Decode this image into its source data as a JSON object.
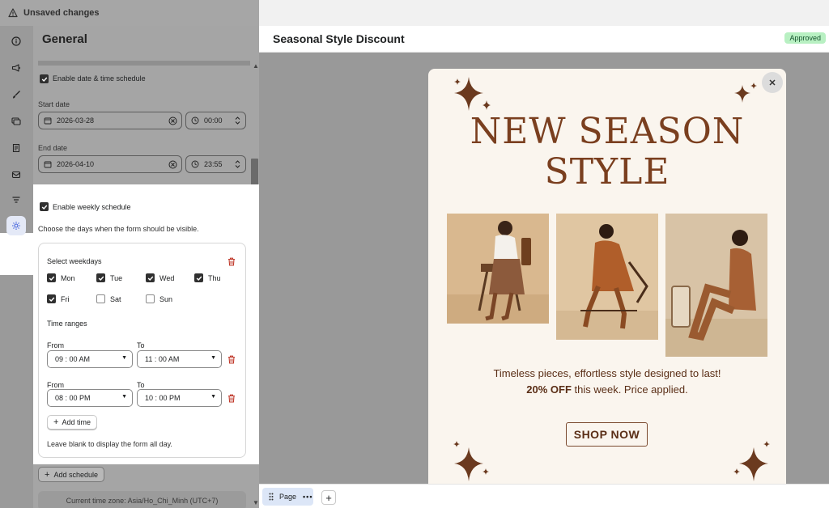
{
  "topbar": {
    "status": "Unsaved changes"
  },
  "panel": {
    "title": "General",
    "schedule": {
      "enable_label": "Enable date & time schedule",
      "start_label": "Start date",
      "start_date": "2026-03-28",
      "start_time": "00:00",
      "end_label": "End date",
      "end_date": "2026-04-10",
      "end_time": "23:55"
    },
    "weekly": {
      "enable_label": "Enable weekly schedule",
      "description": "Choose the days when the form should be visible.",
      "weekdays_label": "Select weekdays",
      "days": [
        {
          "label": "Mon",
          "checked": true
        },
        {
          "label": "Tue",
          "checked": true
        },
        {
          "label": "Wed",
          "checked": true
        },
        {
          "label": "Thu",
          "checked": true
        },
        {
          "label": "Fri",
          "checked": true
        },
        {
          "label": "Sat",
          "checked": false
        },
        {
          "label": "Sun",
          "checked": false
        }
      ],
      "time_ranges_label": "Time ranges",
      "from_label": "From",
      "to_label": "To",
      "ranges": [
        {
          "from": "09 : 00   AM",
          "to": "11 : 00   AM"
        },
        {
          "from": "08 : 00   PM",
          "to": "10 : 00   PM"
        }
      ],
      "add_time_label": "Add time",
      "hint": "Leave blank to display the form all day."
    },
    "add_schedule_label": "Add schedule",
    "timezone": "Current time zone:  Asia/Ho_Chi_Minh (UTC+7)"
  },
  "header": {
    "title": "Seasonal Style Discount",
    "badge": "Approved"
  },
  "popup": {
    "headline_1": "NEW SEASON",
    "headline_2": "STYLE",
    "tagline": "Timeless pieces, effortless style designed to last!",
    "offer_bold": "20% OFF",
    "offer_rest": " this week. Price applied.",
    "cta": "SHOP NOW"
  },
  "pagebar": {
    "page_label": "Page"
  },
  "colors": {
    "accent_brown": "#7a3f1f",
    "badge_green": "#b8f0c2",
    "popup_bg": "#faf5ee"
  },
  "icons": [
    "warning-icon",
    "info-icon",
    "megaphone-icon",
    "brush-icon",
    "cards-icon",
    "receipt-icon",
    "mail-icon",
    "filter-icon",
    "gear-icon"
  ]
}
